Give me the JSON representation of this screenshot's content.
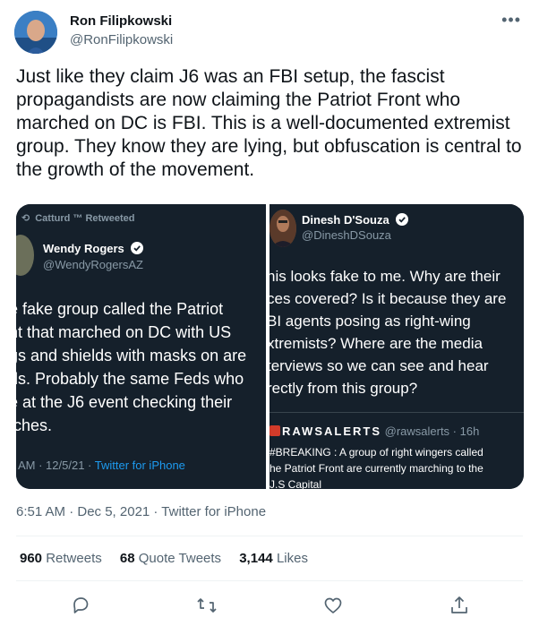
{
  "author": {
    "name": "Ron Filipkowski",
    "handle": "@RonFilipkowski"
  },
  "tweet": {
    "text": "Just like they claim J6 was an FBI setup, the fascist propagandists are now claiming the Patriot Front who marched on DC is FBI. This is a well-documented extremist group. They know they are lying, but obfuscation is central to the growth of the movement."
  },
  "media": {
    "left": {
      "retweet_line": "Catturd ™ Retweeted",
      "name": "Wendy Rogers",
      "handle": "@WendyRogersAZ",
      "text": "e fake group called the Patriot\nnt that marched on DC with US\ngs and shields with masks on are\nds. Probably the same Feds who\ne at the J6 event checking their\ntches.",
      "footer_time": "AM · 12/5/21 · ",
      "footer_source": "Twitter for iPhone"
    },
    "right": {
      "name": "Dinesh D'Souza",
      "handle": "@DineshDSouza",
      "text": "his looks fake to me. Why are their\nces covered? Is it because they are\nBI agents posing as right-wing\nxtremists? Where are the media\nterviews so we can see and hear\nrectly from this group?",
      "quote_name": "RAWSALERTS",
      "quote_meta": "@rawsalerts · 16h",
      "quote_text": "#BREAKING : A group of right wingers called\nhe Patriot Front are currently marching to the\nJ.S Capital"
    }
  },
  "timestamp": "6:51 AM · Dec 5, 2021 · Twitter for iPhone",
  "stats": {
    "retweets_count": "960",
    "retweets_label": "Retweets",
    "quotes_count": "68",
    "quotes_label": "Quote Tweets",
    "likes_count": "3,144",
    "likes_label": "Likes"
  },
  "icons": {
    "reply": "reply-icon",
    "retweet": "retweet-icon",
    "like": "like-icon",
    "share": "share-icon",
    "more": "more-icon",
    "verified": "verified-badge-icon"
  },
  "colors": {
    "accent": "#1d9bf0",
    "text": "#0f1419",
    "muted": "#536471",
    "media_bg": "#15202b"
  }
}
